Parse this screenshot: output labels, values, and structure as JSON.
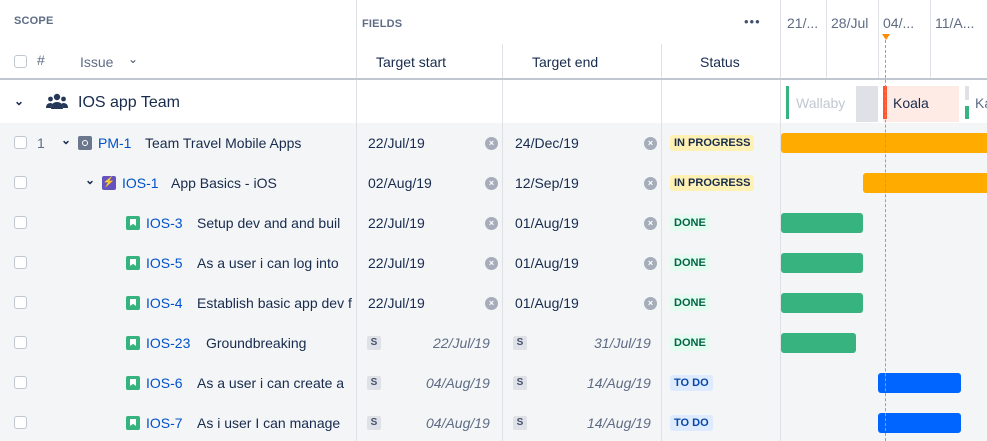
{
  "header": {
    "scope_label": "SCOPE",
    "fields_label": "FIELDS",
    "more_label": "•••",
    "hash_label": "#",
    "issue_label": "Issue",
    "target_start_label": "Target start",
    "target_end_label": "Target end",
    "status_label": "Status",
    "timeline_dates": [
      "21/...",
      "28/Jul",
      "04/...",
      "11/A..."
    ]
  },
  "team": {
    "name": "IOS app Team",
    "sprints": [
      "Wallaby",
      "Koala",
      "Ka"
    ]
  },
  "rows": [
    {
      "num": "1",
      "key": "PM-1",
      "summary": "Team Travel Mobile Apps",
      "start": "22/Jul/19",
      "end": "24/Dec/19",
      "status": "IN PROGRESS"
    },
    {
      "num": "",
      "key": "IOS-1",
      "summary": "App Basics - iOS",
      "start": "02/Aug/19",
      "end": "12/Sep/19",
      "status": "IN PROGRESS"
    },
    {
      "num": "",
      "key": "IOS-3",
      "summary": "Setup dev and and buil",
      "start": "22/Jul/19",
      "end": "01/Aug/19",
      "status": "DONE"
    },
    {
      "num": "",
      "key": "IOS-5",
      "summary": "As a user i can log into",
      "start": "22/Jul/19",
      "end": "01/Aug/19",
      "status": "DONE"
    },
    {
      "num": "",
      "key": "IOS-4",
      "summary": "Establish basic app dev f",
      "start": "22/Jul/19",
      "end": "01/Aug/19",
      "status": "DONE"
    },
    {
      "num": "",
      "key": "IOS-23",
      "summary": "Groundbreaking",
      "start": "22/Jul/19",
      "end": "31/Jul/19",
      "status": "DONE"
    },
    {
      "num": "",
      "key": "IOS-6",
      "summary": "As a user i can create a",
      "start": "04/Aug/19",
      "end": "14/Aug/19",
      "status": "TO DO"
    },
    {
      "num": "",
      "key": "IOS-7",
      "summary": "As i user I can manage",
      "start": "04/Aug/19",
      "end": "14/Aug/19",
      "status": "TO DO"
    }
  ],
  "sprint_badge": "S",
  "clear_glyph": "×",
  "colors": {
    "in_progress_bar": "#ffab00",
    "done_bar": "#36b37e",
    "todo_bar": "#0065ff",
    "link": "#0052cc",
    "today_marker": "#ff8b00"
  }
}
